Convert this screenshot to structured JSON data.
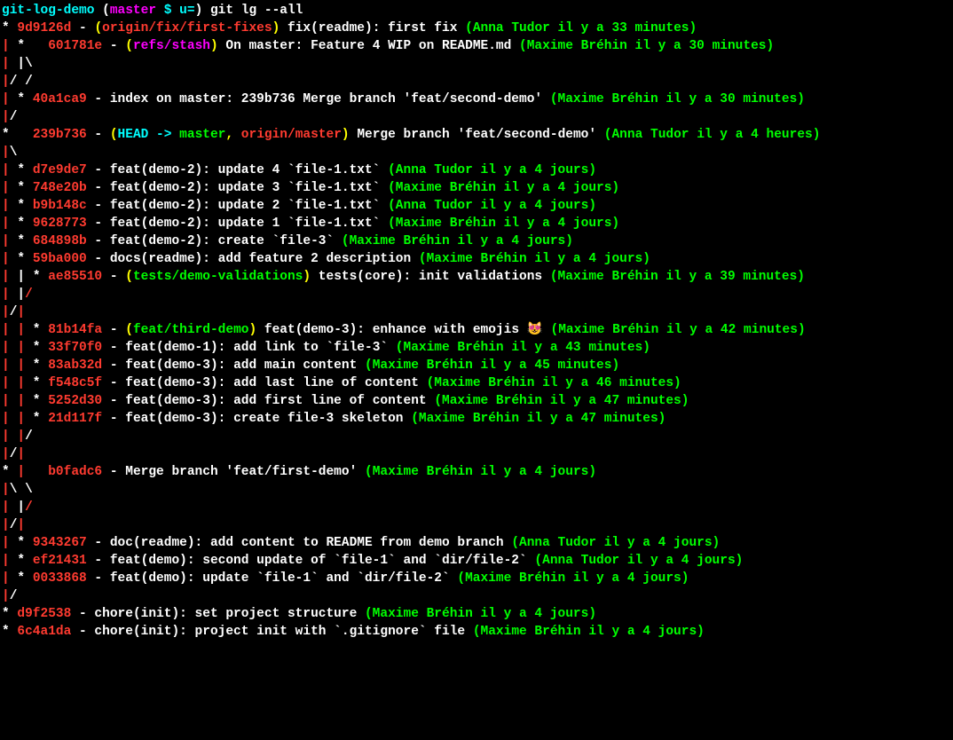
{
  "prompt": {
    "folder": "git-log-demo",
    "open_paren": " (",
    "branch": "master",
    "marker": " $ u=",
    "close_paren": ") ",
    "command": "git lg --all"
  },
  "lines": [
    {
      "segments": [
        {
          "text": "* ",
          "cls": "c-white"
        },
        {
          "text": "9d9126d",
          "cls": "c-red"
        },
        {
          "text": " - ",
          "cls": "c-white"
        },
        {
          "text": "(",
          "cls": "c-yellow"
        },
        {
          "text": "origin/fix/first-fixes",
          "cls": "c-red"
        },
        {
          "text": ")",
          "cls": "c-yellow"
        },
        {
          "text": " fix(readme): first fix ",
          "cls": "c-white"
        },
        {
          "text": "(Anna Tudor il y a 33 minutes)",
          "cls": "c-green"
        }
      ]
    },
    {
      "segments": [
        {
          "text": "| ",
          "cls": "c-red"
        },
        {
          "text": "*   ",
          "cls": "c-white"
        },
        {
          "text": "601781e",
          "cls": "c-red"
        },
        {
          "text": " - ",
          "cls": "c-white"
        },
        {
          "text": "(",
          "cls": "c-yellow"
        },
        {
          "text": "refs/stash",
          "cls": "c-magenta"
        },
        {
          "text": ")",
          "cls": "c-yellow"
        },
        {
          "text": " On master: Feature 4 WIP on README.md ",
          "cls": "c-white"
        },
        {
          "text": "(Maxime Bréhin il y a 30 minutes)",
          "cls": "c-green"
        }
      ]
    },
    {
      "segments": [
        {
          "text": "|",
          "cls": "c-red"
        },
        {
          "text": " |\\",
          "cls": "c-white"
        }
      ]
    },
    {
      "segments": [
        {
          "text": "|",
          "cls": "c-red"
        },
        {
          "text": "/ /",
          "cls": "c-white"
        }
      ]
    },
    {
      "segments": [
        {
          "text": "|",
          "cls": "c-red"
        },
        {
          "text": " * ",
          "cls": "c-white"
        },
        {
          "text": "40a1ca9",
          "cls": "c-red"
        },
        {
          "text": " - index on master: 239b736 Merge branch 'feat/second-demo' ",
          "cls": "c-white"
        },
        {
          "text": "(Maxime Bréhin il y a 30 minutes)",
          "cls": "c-green"
        }
      ]
    },
    {
      "segments": [
        {
          "text": "|",
          "cls": "c-red"
        },
        {
          "text": "/",
          "cls": "c-white"
        }
      ]
    },
    {
      "segments": [
        {
          "text": "*",
          "cls": "c-white"
        },
        {
          "text": "   ",
          "cls": "c-white"
        },
        {
          "text": "239b736",
          "cls": "c-red"
        },
        {
          "text": " - ",
          "cls": "c-white"
        },
        {
          "text": "(",
          "cls": "c-yellow"
        },
        {
          "text": "HEAD -> ",
          "cls": "c-teal"
        },
        {
          "text": "master",
          "cls": "c-green"
        },
        {
          "text": ", ",
          "cls": "c-yellow"
        },
        {
          "text": "origin/master",
          "cls": "c-red"
        },
        {
          "text": ")",
          "cls": "c-yellow"
        },
        {
          "text": " Merge branch 'feat/second-demo' ",
          "cls": "c-white"
        },
        {
          "text": "(Anna Tudor il y a 4 heures)",
          "cls": "c-green"
        }
      ]
    },
    {
      "segments": [
        {
          "text": "|",
          "cls": "c-red"
        },
        {
          "text": "\\",
          "cls": "c-white"
        }
      ]
    },
    {
      "segments": [
        {
          "text": "|",
          "cls": "c-red"
        },
        {
          "text": " * ",
          "cls": "c-white"
        },
        {
          "text": "d7e9de7",
          "cls": "c-red"
        },
        {
          "text": " - feat(demo-2): update 4 `file-1.txt` ",
          "cls": "c-white"
        },
        {
          "text": "(Anna Tudor il y a 4 jours)",
          "cls": "c-green"
        }
      ]
    },
    {
      "segments": [
        {
          "text": "|",
          "cls": "c-red"
        },
        {
          "text": " * ",
          "cls": "c-white"
        },
        {
          "text": "748e20b",
          "cls": "c-red"
        },
        {
          "text": " - feat(demo-2): update 3 `file-1.txt` ",
          "cls": "c-white"
        },
        {
          "text": "(Maxime Bréhin il y a 4 jours)",
          "cls": "c-green"
        }
      ]
    },
    {
      "segments": [
        {
          "text": "|",
          "cls": "c-red"
        },
        {
          "text": " * ",
          "cls": "c-white"
        },
        {
          "text": "b9b148c",
          "cls": "c-red"
        },
        {
          "text": " - feat(demo-2): update 2 `file-1.txt` ",
          "cls": "c-white"
        },
        {
          "text": "(Anna Tudor il y a 4 jours)",
          "cls": "c-green"
        }
      ]
    },
    {
      "segments": [
        {
          "text": "|",
          "cls": "c-red"
        },
        {
          "text": " * ",
          "cls": "c-white"
        },
        {
          "text": "9628773",
          "cls": "c-red"
        },
        {
          "text": " - feat(demo-2): update 1 `file-1.txt` ",
          "cls": "c-white"
        },
        {
          "text": "(Maxime Bréhin il y a 4 jours)",
          "cls": "c-green"
        }
      ]
    },
    {
      "segments": [
        {
          "text": "|",
          "cls": "c-red"
        },
        {
          "text": " * ",
          "cls": "c-white"
        },
        {
          "text": "684898b",
          "cls": "c-red"
        },
        {
          "text": " - feat(demo-2): create `file-3` ",
          "cls": "c-white"
        },
        {
          "text": "(Maxime Bréhin il y a 4 jours)",
          "cls": "c-green"
        }
      ]
    },
    {
      "segments": [
        {
          "text": "|",
          "cls": "c-red"
        },
        {
          "text": " * ",
          "cls": "c-white"
        },
        {
          "text": "59ba000",
          "cls": "c-red"
        },
        {
          "text": " - docs(readme): add feature 2 description ",
          "cls": "c-white"
        },
        {
          "text": "(Maxime Bréhin il y a 4 jours)",
          "cls": "c-green"
        }
      ]
    },
    {
      "segments": [
        {
          "text": "|",
          "cls": "c-red"
        },
        {
          "text": " | ",
          "cls": "c-white"
        },
        {
          "text": "* ",
          "cls": "c-white"
        },
        {
          "text": "ae85510",
          "cls": "c-red"
        },
        {
          "text": " - ",
          "cls": "c-white"
        },
        {
          "text": "(",
          "cls": "c-yellow"
        },
        {
          "text": "tests/demo-validations",
          "cls": "c-green"
        },
        {
          "text": ")",
          "cls": "c-yellow"
        },
        {
          "text": " tests(core): init validations ",
          "cls": "c-white"
        },
        {
          "text": "(Maxime Bréhin il y a 39 minutes)",
          "cls": "c-green"
        }
      ]
    },
    {
      "segments": [
        {
          "text": "|",
          "cls": "c-red"
        },
        {
          "text": " |",
          "cls": "c-white"
        },
        {
          "text": "/",
          "cls": "c-red"
        }
      ]
    },
    {
      "segments": [
        {
          "text": "|",
          "cls": "c-red"
        },
        {
          "text": "/",
          "cls": "c-white"
        },
        {
          "text": "|",
          "cls": "c-red"
        }
      ]
    },
    {
      "segments": [
        {
          "text": "|",
          "cls": "c-red"
        },
        {
          "text": " ",
          "cls": "c-white"
        },
        {
          "text": "|",
          "cls": "c-red"
        },
        {
          "text": " * ",
          "cls": "c-white"
        },
        {
          "text": "81b14fa",
          "cls": "c-red"
        },
        {
          "text": " - ",
          "cls": "c-white"
        },
        {
          "text": "(",
          "cls": "c-yellow"
        },
        {
          "text": "feat/third-demo",
          "cls": "c-green"
        },
        {
          "text": ")",
          "cls": "c-yellow"
        },
        {
          "text": " feat(demo-3): enhance with emojis 😻 ",
          "cls": "c-white"
        },
        {
          "text": "(Maxime Bréhin il y a 42 minutes)",
          "cls": "c-green"
        }
      ]
    },
    {
      "segments": [
        {
          "text": "|",
          "cls": "c-red"
        },
        {
          "text": " ",
          "cls": "c-white"
        },
        {
          "text": "|",
          "cls": "c-red"
        },
        {
          "text": " * ",
          "cls": "c-white"
        },
        {
          "text": "33f70f0",
          "cls": "c-red"
        },
        {
          "text": " - feat(demo-1): add link to `file-3` ",
          "cls": "c-white"
        },
        {
          "text": "(Maxime Bréhin il y a 43 minutes)",
          "cls": "c-green"
        }
      ]
    },
    {
      "segments": [
        {
          "text": "|",
          "cls": "c-red"
        },
        {
          "text": " ",
          "cls": "c-white"
        },
        {
          "text": "|",
          "cls": "c-red"
        },
        {
          "text": " * ",
          "cls": "c-white"
        },
        {
          "text": "83ab32d",
          "cls": "c-red"
        },
        {
          "text": " - feat(demo-3): add main content ",
          "cls": "c-white"
        },
        {
          "text": "(Maxime Bréhin il y a 45 minutes)",
          "cls": "c-green"
        }
      ]
    },
    {
      "segments": [
        {
          "text": "|",
          "cls": "c-red"
        },
        {
          "text": " ",
          "cls": "c-white"
        },
        {
          "text": "|",
          "cls": "c-red"
        },
        {
          "text": " * ",
          "cls": "c-white"
        },
        {
          "text": "f548c5f",
          "cls": "c-red"
        },
        {
          "text": " - feat(demo-3): add last line of content ",
          "cls": "c-white"
        },
        {
          "text": "(Maxime Bréhin il y a 46 minutes)",
          "cls": "c-green"
        }
      ]
    },
    {
      "segments": [
        {
          "text": "|",
          "cls": "c-red"
        },
        {
          "text": " ",
          "cls": "c-white"
        },
        {
          "text": "|",
          "cls": "c-red"
        },
        {
          "text": " * ",
          "cls": "c-white"
        },
        {
          "text": "5252d30",
          "cls": "c-red"
        },
        {
          "text": " - feat(demo-3): add first line of content ",
          "cls": "c-white"
        },
        {
          "text": "(Maxime Bréhin il y a 47 minutes)",
          "cls": "c-green"
        }
      ]
    },
    {
      "segments": [
        {
          "text": "|",
          "cls": "c-red"
        },
        {
          "text": " ",
          "cls": "c-white"
        },
        {
          "text": "|",
          "cls": "c-red"
        },
        {
          "text": " * ",
          "cls": "c-white"
        },
        {
          "text": "21d117f",
          "cls": "c-red"
        },
        {
          "text": " - feat(demo-3): create file-3 skeleton ",
          "cls": "c-white"
        },
        {
          "text": "(Maxime Bréhin il y a 47 minutes)",
          "cls": "c-green"
        }
      ]
    },
    {
      "segments": [
        {
          "text": "|",
          "cls": "c-red"
        },
        {
          "text": " ",
          "cls": "c-white"
        },
        {
          "text": "|",
          "cls": "c-red"
        },
        {
          "text": "/",
          "cls": "c-white"
        }
      ]
    },
    {
      "segments": [
        {
          "text": "|",
          "cls": "c-red"
        },
        {
          "text": "/",
          "cls": "c-white"
        },
        {
          "text": "|",
          "cls": "c-red"
        }
      ]
    },
    {
      "segments": [
        {
          "text": "* ",
          "cls": "c-white"
        },
        {
          "text": "|",
          "cls": "c-red"
        },
        {
          "text": "   ",
          "cls": "c-white"
        },
        {
          "text": "b0fadc6",
          "cls": "c-red"
        },
        {
          "text": " - Merge branch 'feat/first-demo' ",
          "cls": "c-white"
        },
        {
          "text": "(Maxime Bréhin il y a 4 jours)",
          "cls": "c-green"
        }
      ]
    },
    {
      "segments": [
        {
          "text": "|",
          "cls": "c-red"
        },
        {
          "text": "\\ \\",
          "cls": "c-white"
        }
      ]
    },
    {
      "segments": [
        {
          "text": "|",
          "cls": "c-red"
        },
        {
          "text": " |",
          "cls": "c-white"
        },
        {
          "text": "/",
          "cls": "c-red"
        }
      ]
    },
    {
      "segments": [
        {
          "text": "|",
          "cls": "c-red"
        },
        {
          "text": "/",
          "cls": "c-white"
        },
        {
          "text": "|",
          "cls": "c-red"
        }
      ]
    },
    {
      "segments": [
        {
          "text": "|",
          "cls": "c-red"
        },
        {
          "text": " * ",
          "cls": "c-white"
        },
        {
          "text": "9343267",
          "cls": "c-red"
        },
        {
          "text": " - doc(readme): add content to README from demo branch ",
          "cls": "c-white"
        },
        {
          "text": "(Anna Tudor il y a 4 jours)",
          "cls": "c-green"
        }
      ]
    },
    {
      "segments": [
        {
          "text": "|",
          "cls": "c-red"
        },
        {
          "text": " * ",
          "cls": "c-white"
        },
        {
          "text": "ef21431",
          "cls": "c-red"
        },
        {
          "text": " - feat(demo): second update of `file-1` and `dir/file-2` ",
          "cls": "c-white"
        },
        {
          "text": "(Anna Tudor il y a 4 jours)",
          "cls": "c-green"
        }
      ]
    },
    {
      "segments": [
        {
          "text": "|",
          "cls": "c-red"
        },
        {
          "text": " * ",
          "cls": "c-white"
        },
        {
          "text": "0033868",
          "cls": "c-red"
        },
        {
          "text": " - feat(demo): update `file-1` and `dir/file-2` ",
          "cls": "c-white"
        },
        {
          "text": "(Maxime Bréhin il y a 4 jours)",
          "cls": "c-green"
        }
      ]
    },
    {
      "segments": [
        {
          "text": "|",
          "cls": "c-red"
        },
        {
          "text": "/",
          "cls": "c-white"
        }
      ]
    },
    {
      "segments": [
        {
          "text": "* ",
          "cls": "c-white"
        },
        {
          "text": "d9f2538",
          "cls": "c-red"
        },
        {
          "text": " - chore(init): set project structure ",
          "cls": "c-white"
        },
        {
          "text": "(Maxime Bréhin il y a 4 jours)",
          "cls": "c-green"
        }
      ]
    },
    {
      "segments": [
        {
          "text": "* ",
          "cls": "c-white"
        },
        {
          "text": "6c4a1da",
          "cls": "c-red"
        },
        {
          "text": " - chore(init): project init with `.gitignore` file ",
          "cls": "c-white"
        },
        {
          "text": "(Maxime Bréhin il y a 4 jours)",
          "cls": "c-green"
        }
      ]
    }
  ]
}
